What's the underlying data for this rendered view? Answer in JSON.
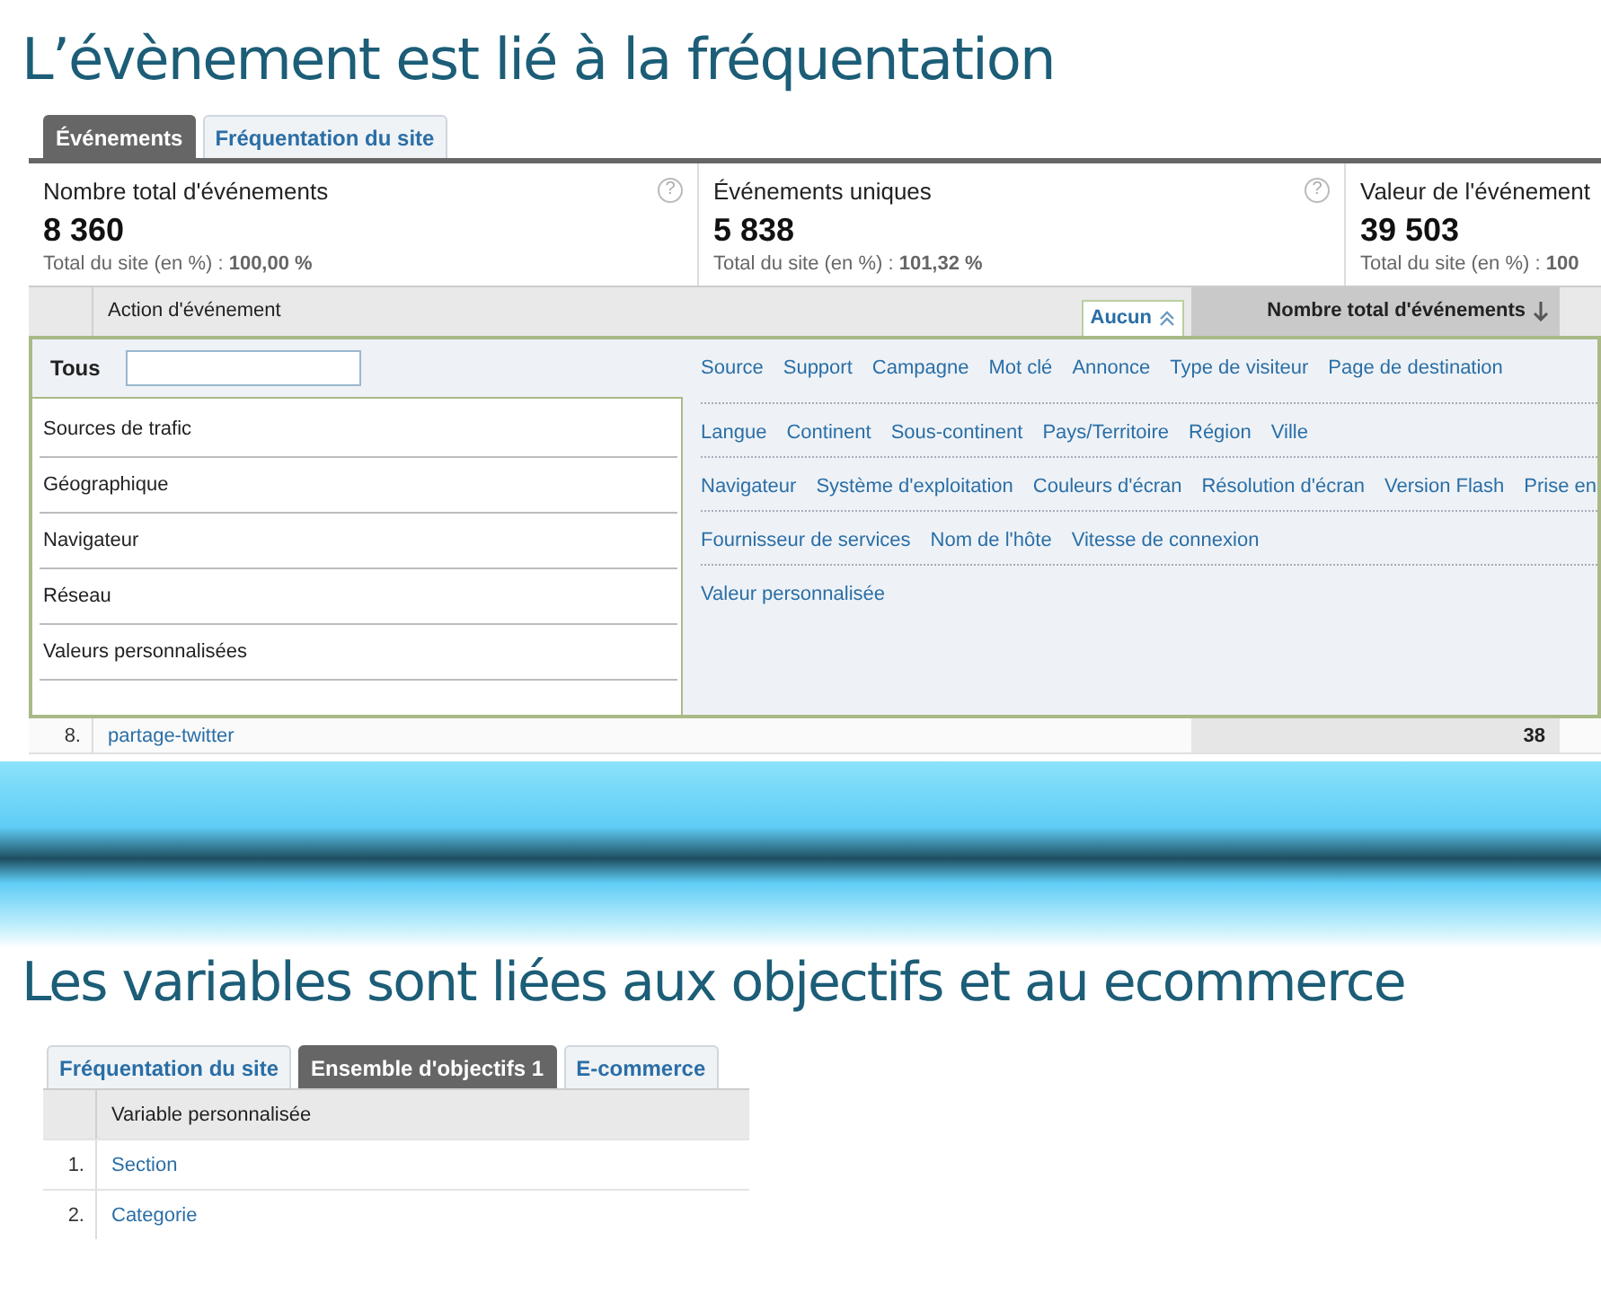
{
  "heading_1": "L’évènement est lié à la fréquentation",
  "tabs_1": [
    {
      "label": "Événements",
      "selected": true
    },
    {
      "label": "Fréquentation du site",
      "selected": false
    }
  ],
  "metrics": [
    {
      "label": "Nombre total d'événements",
      "value": "8 360",
      "share": "Total du site (en %) : **100,00 %**",
      "help": "?"
    },
    {
      "label": "Événements uniques",
      "value": "5 838",
      "share": "Total du site (en %) : **101,32 %**",
      "help": "?"
    },
    {
      "label": "Valeur de l'événement",
      "value": "39 503",
      "share": "Total du site (en %) : **100**"
    }
  ],
  "table_1": {
    "columns": [
      {
        "label": "Action d'événement",
        "sorted": false
      },
      {
        "label": "Nombre total d'événements",
        "sorted": true
      }
    ],
    "dimension_button": "Aucun",
    "rows": [
      {
        "index": "8.",
        "label": "partage-twitter",
        "value": "38"
      }
    ]
  },
  "dimension_menu": {
    "search_label": "Tous",
    "categories": [
      "Sources de trafic",
      "Géographique",
      "Navigateur",
      "Réseau",
      "Valeurs personnalisées"
    ],
    "groups": [
      [
        "Source",
        "Support",
        "Campagne",
        "Mot clé",
        "Annonce",
        "Type de visiteur",
        "Page de destination"
      ],
      [
        "Langue",
        "Continent",
        "Sous-continent",
        "Pays/Territoire",
        "Région",
        "Ville"
      ],
      [
        "Navigateur",
        "Système d'exploitation",
        "Couleurs d'écran",
        "Résolution d'écran",
        "Version Flash",
        "Prise en"
      ],
      [
        "Fournisseur de services",
        "Nom de l'hôte",
        "Vitesse de connexion"
      ],
      [
        "Valeur personnalisée"
      ]
    ]
  },
  "heading_2": "Les variables sont liées aux objectifs et au ecommerce",
  "tabs_2": [
    {
      "label": "Fréquentation du site",
      "selected": false
    },
    {
      "label": "Ensemble d'objectifs 1",
      "selected": true
    },
    {
      "label": "E-commerce",
      "selected": false
    }
  ],
  "table_2": {
    "columns": [
      {
        "label": "Variable personnalisée"
      }
    ],
    "rows": [
      {
        "index": "1.",
        "label": "Section"
      },
      {
        "index": "2.",
        "label": "Categorie"
      }
    ]
  }
}
